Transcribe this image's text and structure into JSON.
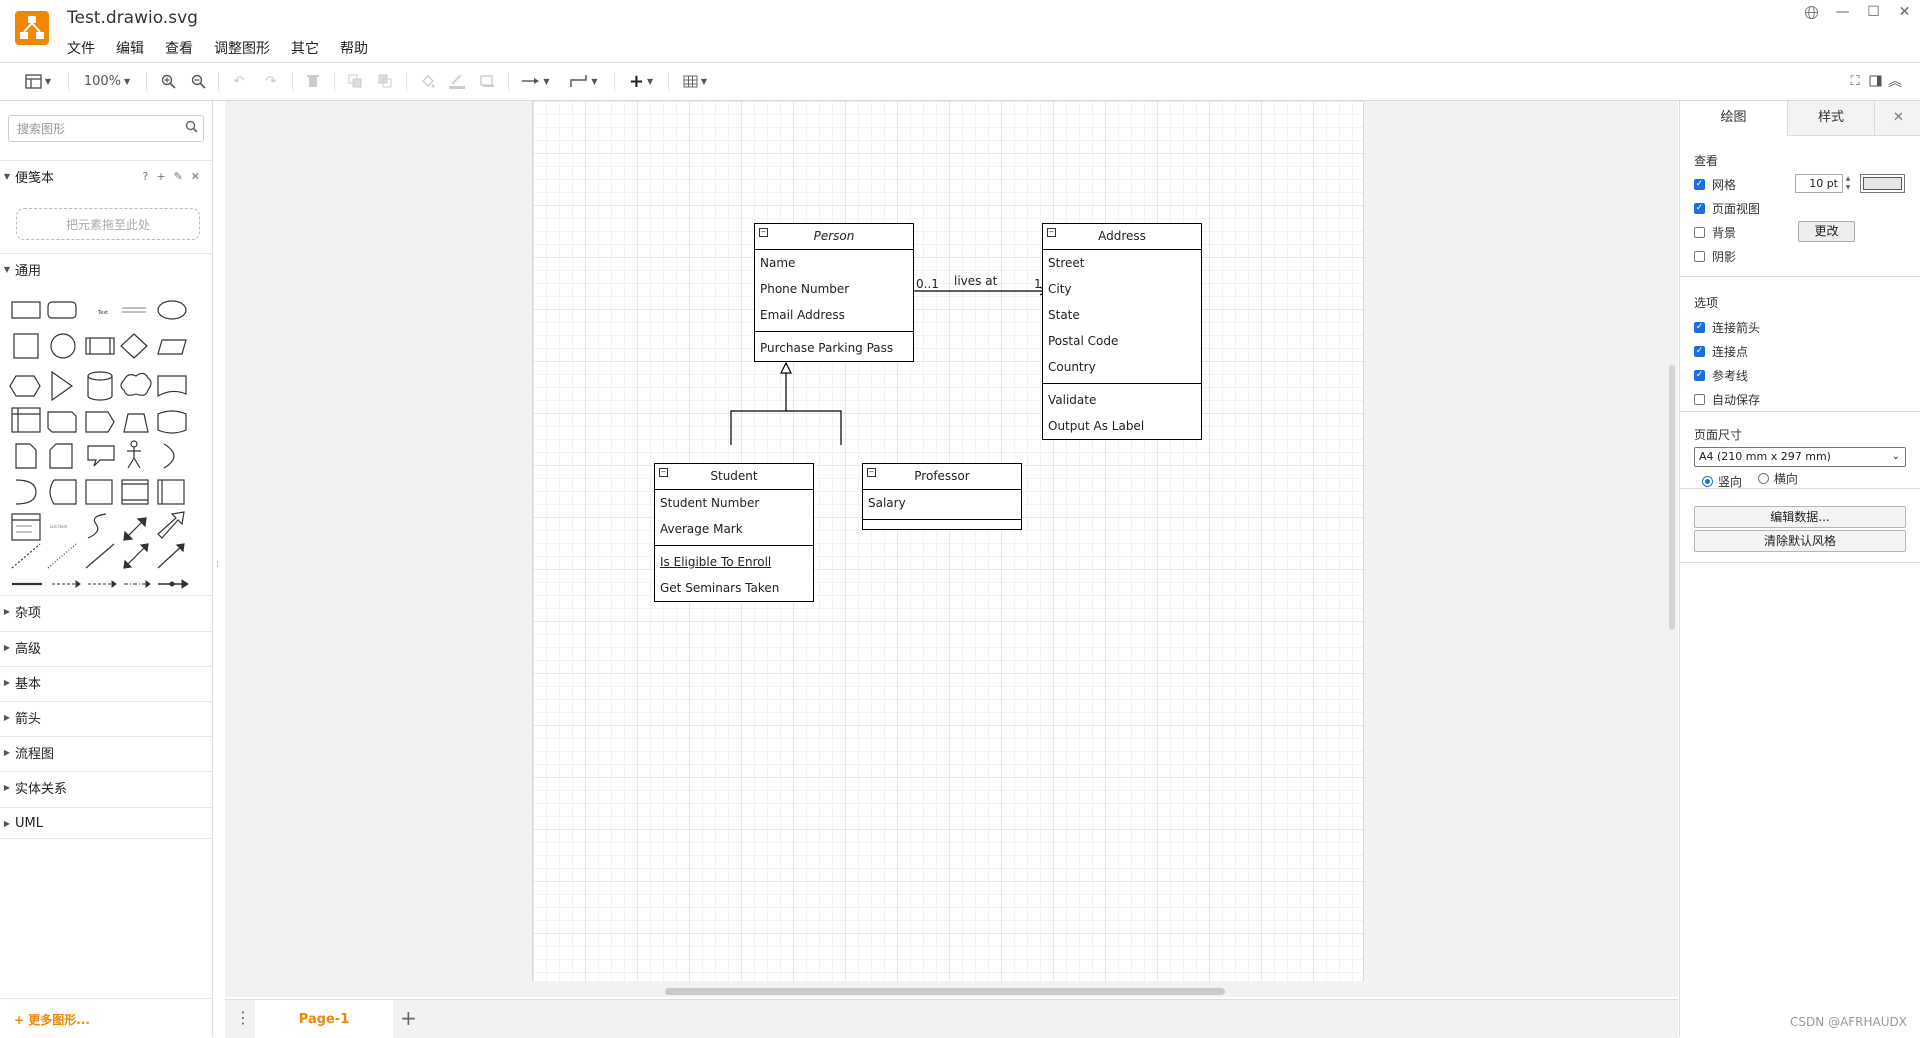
{
  "window": {
    "file_title": "Test.drawio.svg",
    "menu": [
      "文件",
      "编辑",
      "查看",
      "调整图形",
      "其它",
      "帮助"
    ]
  },
  "toolbar": {
    "zoom": "100%"
  },
  "sidebar": {
    "search_placeholder": "搜索图形",
    "scratchpad": {
      "title": "便笺本",
      "tools": [
        "?",
        "+",
        "✎",
        "✕"
      ],
      "dropzone": "把元素拖至此处"
    },
    "general_title": "通用",
    "categories": [
      "杂项",
      "高级",
      "基本",
      "箭头",
      "流程图",
      "实体关系",
      "UML"
    ],
    "more_shapes": "+ 更多图形..."
  },
  "diagram": {
    "person": {
      "name": "Person",
      "attributes": [
        "Name",
        "Phone Number",
        "Email Address"
      ],
      "operations": [
        "Purchase Parking Pass"
      ]
    },
    "address": {
      "name": "Address",
      "attributes": [
        "Street",
        "City",
        "State",
        "Postal Code",
        "Country"
      ],
      "operations": [
        "Validate",
        "Output As Label"
      ]
    },
    "student": {
      "name": "Student",
      "attributes": [
        "Student Number",
        "Average Mark"
      ],
      "operations": [
        "Is Eligible To Enroll",
        "Get Seminars Taken"
      ]
    },
    "professor": {
      "name": "Professor",
      "attributes": [
        "Salary"
      ]
    },
    "association": {
      "label": "lives at",
      "source_multiplicity": "0..1",
      "target_multiplicity": "1"
    }
  },
  "pages": {
    "current": "Page-1"
  },
  "format_panel": {
    "tabs": [
      "绘图",
      "样式"
    ],
    "view": {
      "title": "查看",
      "grid_label": "网格",
      "grid_checked": true,
      "grid_size": "10 pt",
      "page_view_label": "页面视图",
      "page_view_checked": true,
      "background_label": "背景",
      "background_checked": false,
      "change_button": "更改",
      "shadow_label": "阴影",
      "shadow_checked": false
    },
    "options": {
      "title": "选项",
      "connection_arrows": "连接箭头",
      "connection_points": "连接点",
      "guides": "参考线",
      "autosave": "自动保存"
    },
    "paper": {
      "title": "页面尺寸",
      "size": "A4 (210 mm x 297 mm)",
      "portrait": "竖向",
      "landscape": "横向"
    },
    "buttons": {
      "edit_data": "编辑数据...",
      "clear_style": "清除默认风格"
    }
  },
  "watermark": "CSDN @AFRHAUDX",
  "colors": {
    "accent": "#f08705",
    "checkbox": "#1a6fe0"
  }
}
